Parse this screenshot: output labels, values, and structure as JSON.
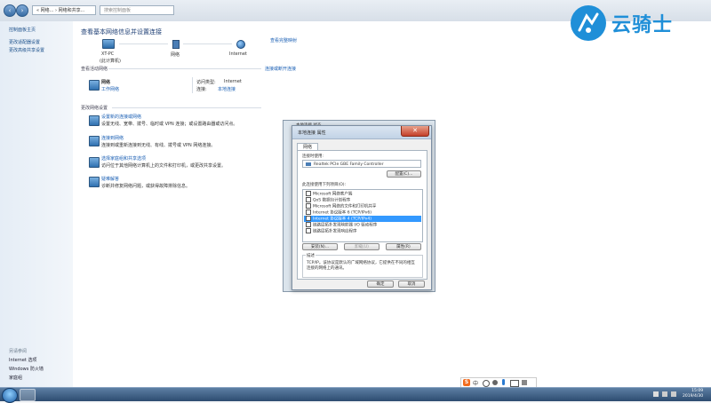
{
  "address_bar": {
    "path": "« 网络... › 网络和共享...",
    "search_placeholder": "搜索控制面板"
  },
  "left_pane": {
    "home": "控制面板主页",
    "links": [
      "更改适配器设置",
      "更改高级共享设置"
    ],
    "see_also_title": "另请参阅",
    "see_also": [
      "Internet 选项",
      "Windows 防火墙",
      "家庭组"
    ]
  },
  "main": {
    "title": "查看基本网络信息并设置连接",
    "view_full_map": "查看完整映射",
    "map": {
      "pc_name": "XT-PC",
      "pc_sub": "(此计算机)",
      "network": "网络",
      "internet": "Internet"
    },
    "active_networks_title": "查看活动网络",
    "connect_disconnect": "连接或断开连接",
    "network_name": "网络",
    "network_type": "工作网络",
    "access_type_label": "访问类型:",
    "access_type_value": "Internet",
    "connections_label": "连接:",
    "connections_value": "本地连接",
    "change_settings_title": "更改网络设置",
    "tasks": [
      {
        "title": "设置新的连接或网络",
        "desc": "设置无线、宽带、拨号、临时或 VPN 连接；或设置路由器或访问点。"
      },
      {
        "title": "连接到网络",
        "desc": "连接到或重新连接到无线、有线、拨号或 VPN 网络连接。"
      },
      {
        "title": "选择家庭组和共享选项",
        "desc": "访问位于其他网络计算机上的文件和打印机，或更改共享设置。"
      },
      {
        "title": "疑难解答",
        "desc": "诊断并修复网络问题，或获得故障排除信息。"
      }
    ]
  },
  "dialog": {
    "outer_title": "本地连接 状态",
    "title": "本地连接 属性",
    "close_symbol": "✕",
    "tab": "网络",
    "connect_using_label": "连接时使用:",
    "adapter": "Realtek PCIe GBE Family Controller",
    "configure_btn": "配置(C)...",
    "items_label": "此连接使用下列项目(O):",
    "items": [
      {
        "label": "Microsoft 网络客户端",
        "checked": true,
        "selected": false
      },
      {
        "label": "QoS 数据包计划程序",
        "checked": true,
        "selected": false
      },
      {
        "label": "Microsoft 网络的文件和打印机共享",
        "checked": true,
        "selected": false
      },
      {
        "label": "Internet 协议版本 6 (TCP/IPv6)",
        "checked": true,
        "selected": false
      },
      {
        "label": "Internet 协议版本 4 (TCP/IPv4)",
        "checked": true,
        "selected": true
      },
      {
        "label": "链路层拓扑发现映射器 I/O 驱动程序",
        "checked": true,
        "selected": false
      },
      {
        "label": "链路层拓扑发现响应程序",
        "checked": true,
        "selected": false
      }
    ],
    "install_btn": "安装(N)...",
    "uninstall_btn": "卸载(U)",
    "properties_btn": "属性(R)",
    "description_title": "描述",
    "description": "TCP/IP。该协议是默认的广域网络协议，它提供在不同的相互连接的网络上的通讯。",
    "ok_btn": "确定",
    "cancel_btn": "取消"
  },
  "watermark": {
    "text": "云骑士"
  },
  "taskbar": {
    "time": "15:09",
    "date": "2019/4/30"
  },
  "ime": {
    "logo": "S",
    "mode": "中"
  }
}
